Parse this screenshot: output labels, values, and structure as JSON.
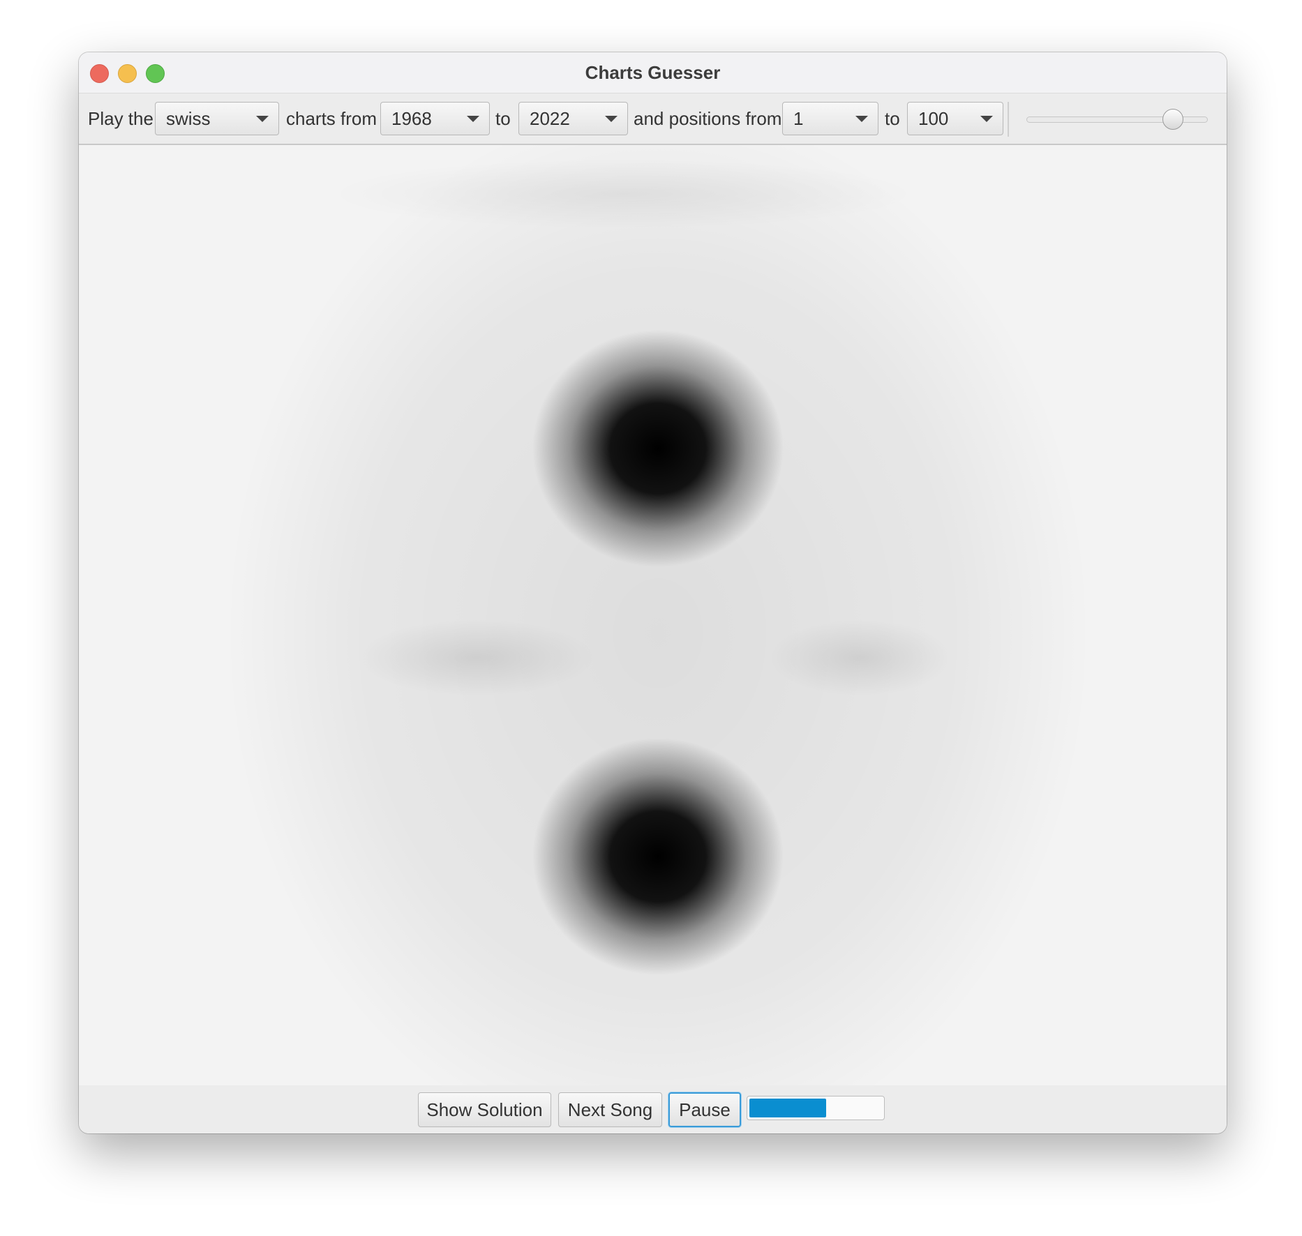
{
  "window": {
    "title": "Charts Guesser"
  },
  "toolbar": {
    "label_play": "Play the",
    "chart_select": "swiss",
    "label_charts_from": "charts from",
    "year_from": "1968",
    "label_to_1": "to",
    "year_to": "2022",
    "label_positions_from": "and positions from",
    "position_from": "1",
    "label_to_2": "to",
    "position_to": "100",
    "volume_slider_fraction": 0.9
  },
  "controls": {
    "show_solution_label": "Show Solution",
    "next_song_label": "Next Song",
    "pause_label": "Pause",
    "playback_progress_fraction": 0.58
  },
  "colors": {
    "progress_fill": "#0a8ed0",
    "focus_ring": "#3a9bd8"
  }
}
